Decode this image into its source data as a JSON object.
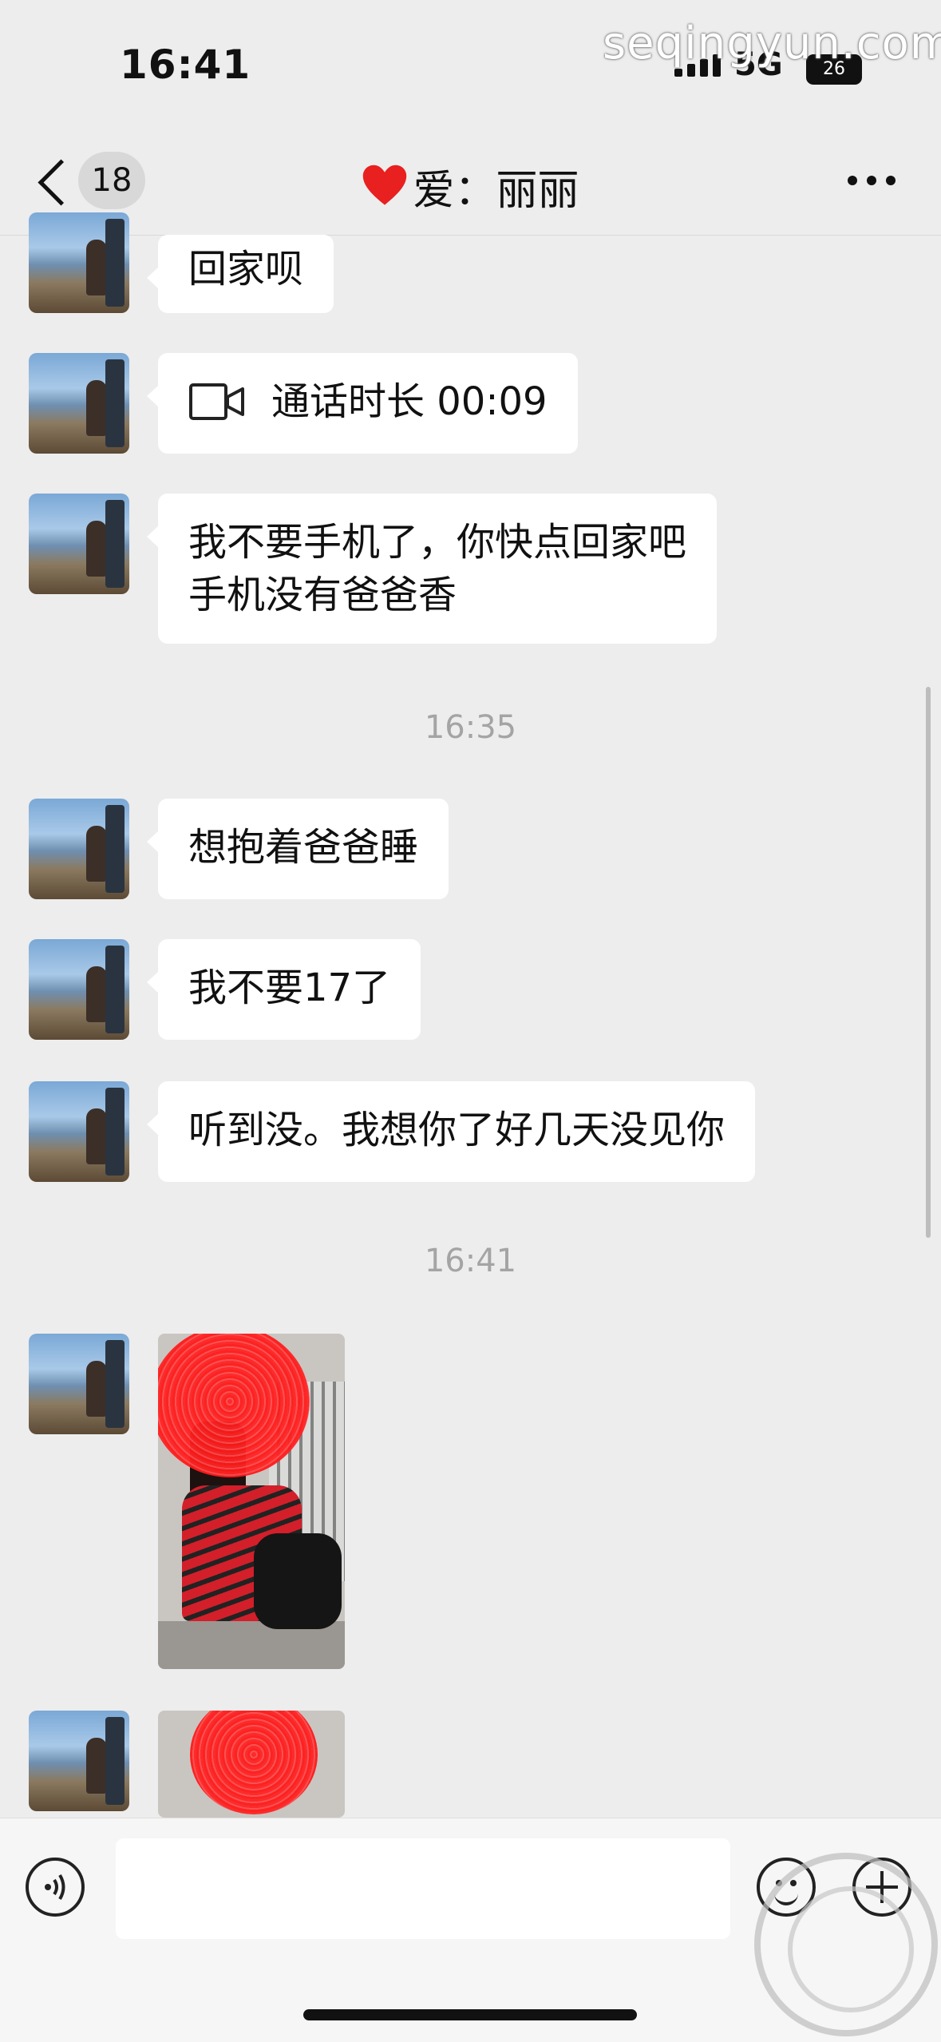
{
  "status_bar": {
    "time": "16:41",
    "network": "5G",
    "battery": "26"
  },
  "watermark": "seqingyun.com",
  "nav": {
    "unread_count": "18",
    "title": "爱：丽丽"
  },
  "messages": [
    {
      "type": "text",
      "text": "回家呗"
    },
    {
      "type": "call",
      "text": "通话时长 00:09"
    },
    {
      "type": "text",
      "lines": [
        "我不要手机了，你快点回家吧",
        "手机没有爸爸香"
      ]
    },
    {
      "type": "timestamp",
      "text": "16:35"
    },
    {
      "type": "text",
      "text": "想抱着爸爸睡"
    },
    {
      "type": "text",
      "text": "我不要17了"
    },
    {
      "type": "text",
      "text": "听到没。我想你了好几天没见你"
    },
    {
      "type": "timestamp",
      "text": "16:41"
    },
    {
      "type": "image",
      "icon": "photo-image"
    },
    {
      "type": "image",
      "icon": "photo-image"
    }
  ],
  "input_bar": {
    "placeholder": ""
  }
}
